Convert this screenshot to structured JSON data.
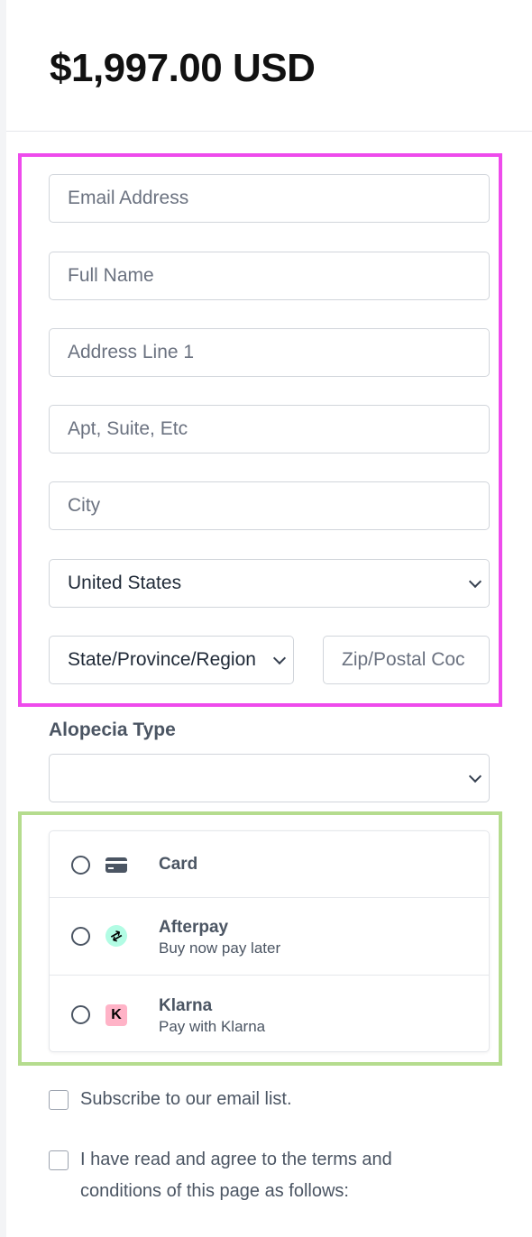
{
  "header": {
    "price": "$1,997.00 USD"
  },
  "form": {
    "email_placeholder": "Email Address",
    "full_name_placeholder": "Full Name",
    "address1_placeholder": "Address Line 1",
    "address2_placeholder": "Apt, Suite, Etc",
    "city_placeholder": "City",
    "country_value": "United States",
    "state_value": "State/Province/Region",
    "zip_placeholder": "Zip/Postal Coc"
  },
  "alopecia": {
    "label": "Alopecia Type",
    "value": ""
  },
  "payment": {
    "options": [
      {
        "title": "Card",
        "subtitle": "",
        "icon": "credit-card-icon"
      },
      {
        "title": "Afterpay",
        "subtitle": "Buy now pay later",
        "icon": "afterpay-logo-icon"
      },
      {
        "title": "Klarna",
        "subtitle": "Pay with Klarna",
        "icon": "klarna-logo-icon"
      }
    ],
    "afterpay_glyph": "⇄",
    "klarna_glyph": "K"
  },
  "checkboxes": {
    "subscribe_label": "Subscribe to our email list.",
    "terms_line1": "I have read and agree to the terms and",
    "terms_line2": "conditions of this page as follows:"
  },
  "colors": {
    "highlight_pink": "#ee4bec",
    "highlight_green": "#b5dc8e",
    "afterpay_mint": "#b2fce4",
    "klarna_pink": "#ffb3c7"
  }
}
